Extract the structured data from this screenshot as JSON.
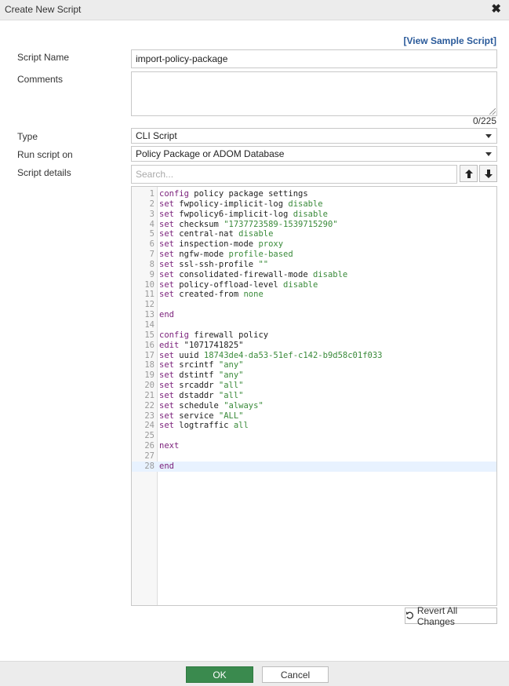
{
  "dialog": {
    "title": "Create New Script",
    "close_icon": "close-icon"
  },
  "sample_link": "[View Sample Script]",
  "form": {
    "script_name_label": "Script Name",
    "script_name_value": "import-policy-package",
    "comments_label": "Comments",
    "comments_value": "",
    "counter": "0/225",
    "type_label": "Type",
    "type_value": "CLI Script",
    "run_on_label": "Run script on",
    "run_on_value": "Policy Package or ADOM Database",
    "details_label": "Script details",
    "search_placeholder": "Search..."
  },
  "editor": {
    "active_line": 28,
    "lines": [
      [
        [
          "kw",
          "config"
        ],
        [
          "p",
          " policy package settings"
        ]
      ],
      [
        [
          "kw",
          "set"
        ],
        [
          "p",
          " fwpolicy-implicit-log "
        ],
        [
          "val",
          "disable"
        ]
      ],
      [
        [
          "kw",
          "set"
        ],
        [
          "p",
          " fwpolicy6-implicit-log "
        ],
        [
          "val",
          "disable"
        ]
      ],
      [
        [
          "kw",
          "set"
        ],
        [
          "p",
          " checksum "
        ],
        [
          "str",
          "\"1737723589-1539715290\""
        ]
      ],
      [
        [
          "kw",
          "set"
        ],
        [
          "p",
          " central-nat "
        ],
        [
          "val",
          "disable"
        ]
      ],
      [
        [
          "kw",
          "set"
        ],
        [
          "p",
          " inspection-mode "
        ],
        [
          "val",
          "proxy"
        ]
      ],
      [
        [
          "kw",
          "set"
        ],
        [
          "p",
          " ngfw-mode "
        ],
        [
          "val",
          "profile-based"
        ]
      ],
      [
        [
          "kw",
          "set"
        ],
        [
          "p",
          " ssl-ssh-profile "
        ],
        [
          "str",
          "\"\""
        ]
      ],
      [
        [
          "kw",
          "set"
        ],
        [
          "p",
          " consolidated-firewall-mode "
        ],
        [
          "val",
          "disable"
        ]
      ],
      [
        [
          "kw",
          "set"
        ],
        [
          "p",
          " policy-offload-level "
        ],
        [
          "val",
          "disable"
        ]
      ],
      [
        [
          "kw",
          "set"
        ],
        [
          "p",
          " created-from "
        ],
        [
          "val",
          "none"
        ]
      ],
      [],
      [
        [
          "kw",
          "end"
        ]
      ],
      [],
      [
        [
          "kw",
          "config"
        ],
        [
          "p",
          " firewall policy"
        ]
      ],
      [
        [
          "kw",
          "edit"
        ],
        [
          "p",
          " \"1071741825\""
        ]
      ],
      [
        [
          "kw",
          "set"
        ],
        [
          "p",
          " uuid "
        ],
        [
          "val",
          "18743de4-da53-51ef-c142-b9d58c01f033"
        ]
      ],
      [
        [
          "kw",
          "set"
        ],
        [
          "p",
          " srcintf "
        ],
        [
          "str",
          "\"any\""
        ]
      ],
      [
        [
          "kw",
          "set"
        ],
        [
          "p",
          " dstintf "
        ],
        [
          "str",
          "\"any\""
        ]
      ],
      [
        [
          "kw",
          "set"
        ],
        [
          "p",
          " srcaddr "
        ],
        [
          "str",
          "\"all\""
        ]
      ],
      [
        [
          "kw",
          "set"
        ],
        [
          "p",
          " dstaddr "
        ],
        [
          "str",
          "\"all\""
        ]
      ],
      [
        [
          "kw",
          "set"
        ],
        [
          "p",
          " schedule "
        ],
        [
          "str",
          "\"always\""
        ]
      ],
      [
        [
          "kw",
          "set"
        ],
        [
          "p",
          " service "
        ],
        [
          "str",
          "\"ALL\""
        ]
      ],
      [
        [
          "kw",
          "set"
        ],
        [
          "p",
          " logtraffic "
        ],
        [
          "val",
          "all"
        ]
      ],
      [],
      [
        [
          "kw",
          "next"
        ]
      ],
      [],
      [
        [
          "kw",
          "end"
        ]
      ]
    ]
  },
  "buttons": {
    "revert": "Revert All Changes",
    "ok": "OK",
    "cancel": "Cancel"
  }
}
